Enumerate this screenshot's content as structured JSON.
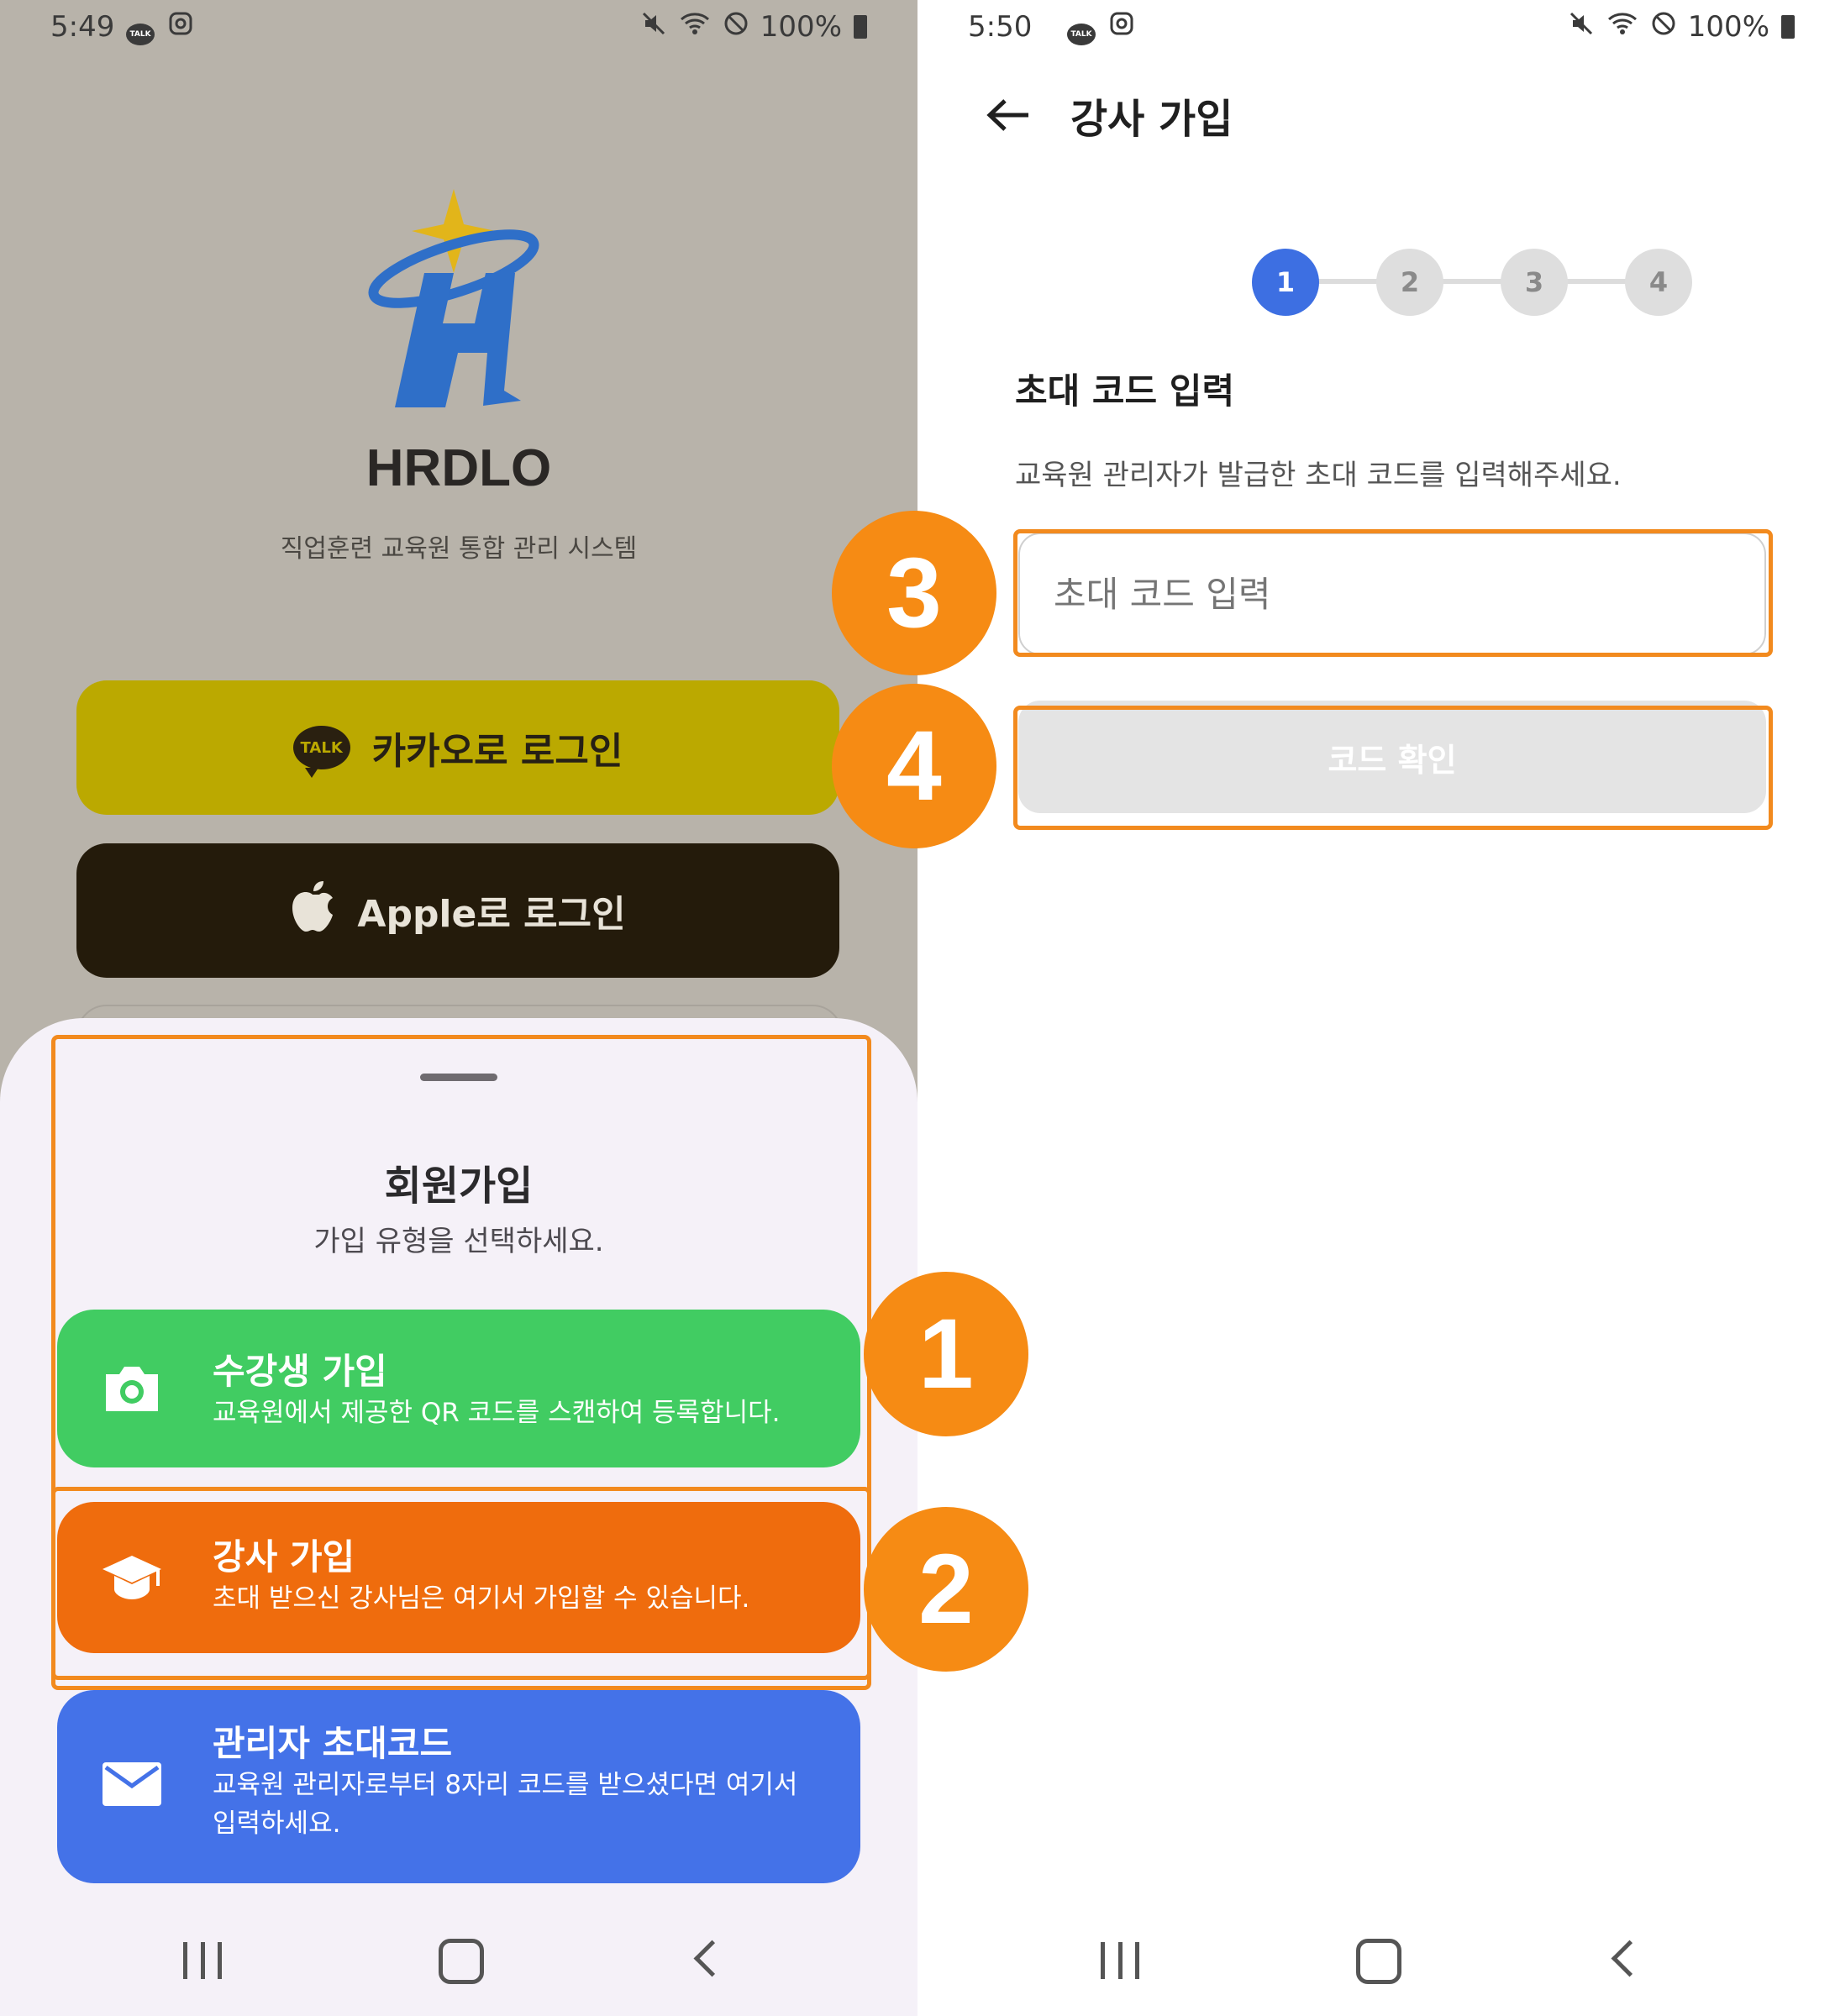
{
  "left": {
    "status": {
      "time": "5:49",
      "battery": "100%"
    },
    "app_name": "HRDLO",
    "app_subtitle": "직업훈련 교육원 통합 관리 시스템",
    "kakao_login": "카카오로 로그인",
    "kakao_icon_text": "TALK",
    "apple_login": "Apple로 로그인",
    "sheet": {
      "title": "회원가입",
      "subtitle": "가입 유형을 선택하세요.",
      "options": [
        {
          "title": "수강생 가입",
          "desc": "교육원에서 제공한 QR 코드를 스캔하여 등록합니다.",
          "icon": "camera-icon",
          "color": "#41cc62"
        },
        {
          "title": "강사 가입",
          "desc": "초대 받으신 강사님은 여기서 가입할 수 있습니다.",
          "icon": "graduation-cap-icon",
          "color": "#ef6c0d"
        },
        {
          "title": "관리자 초대코드",
          "desc": "교육원 관리자로부터 8자리 코드를 받으셨다면 여기서 입력하세요.",
          "icon": "mail-icon",
          "color": "#4472e8"
        }
      ]
    }
  },
  "right": {
    "status": {
      "time": "5:50",
      "battery": "100%"
    },
    "header_title": "강사 가입",
    "steps": [
      "1",
      "2",
      "3",
      "4"
    ],
    "active_step": 1,
    "section_title": "초대 코드 입력",
    "section_desc": "교육원 관리자가 발급한 초대 코드를 입력해주세요.",
    "input_placeholder": "초대 코드 입력",
    "confirm_label": "코드 확인"
  },
  "badges": [
    "1",
    "2",
    "3",
    "4"
  ],
  "colors": {
    "highlight": "#f28a1e",
    "badge": "#f68b14",
    "primary": "#3d6fe2",
    "kakao": "#bba900"
  }
}
